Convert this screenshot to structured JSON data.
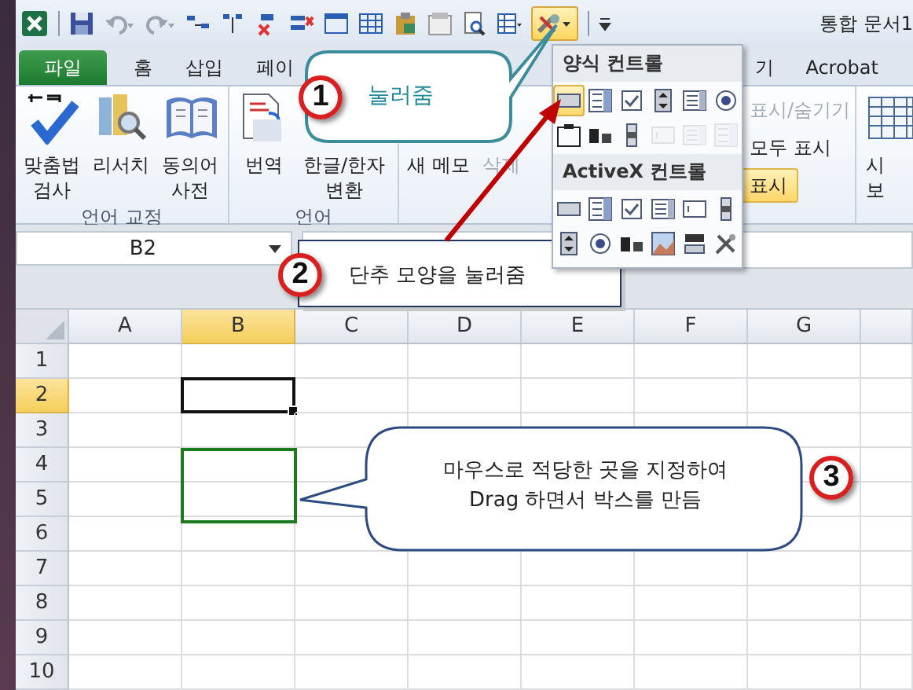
{
  "window": {
    "title": "통합 문서1"
  },
  "quick_access": {
    "controls_button": {
      "expanded": true
    }
  },
  "tabs": [
    {
      "label": "파일",
      "selected": true
    },
    {
      "label": "홈",
      "selected": false
    },
    {
      "label": "삽입",
      "selected": false
    },
    {
      "label": "페이",
      "selected": false
    },
    {
      "label": "기",
      "selected": false
    },
    {
      "label": "Acrobat",
      "selected": false
    }
  ],
  "ribbon": [
    {
      "kind": "large",
      "label": "언어 교정",
      "buttons": [
        {
          "label": "맞춤법\n검사"
        },
        {
          "label": "리서치"
        },
        {
          "label": "동의어\n사전"
        }
      ]
    },
    {
      "kind": "large",
      "label": "언어",
      "buttons": [
        {
          "label": "번역"
        },
        {
          "label": "한글/한자\n변환"
        }
      ]
    },
    {
      "kind": "text",
      "buttons": [
        {
          "label": "새 메모",
          "disabled": false
        },
        {
          "label": "삭제",
          "disabled": true
        }
      ]
    },
    {
      "kind": "small",
      "buttons": [
        {
          "label": "표시/숨기기",
          "disabled": true,
          "selected": false
        },
        {
          "label": "모두 표시",
          "disabled": false,
          "selected": false
        },
        {
          "label": "표시",
          "disabled": false,
          "selected": true
        }
      ]
    },
    {
      "kind": "large",
      "buttons": [
        {
          "label": "시\n보"
        }
      ]
    }
  ],
  "name_box": "B2",
  "columns": [
    {
      "label": "A",
      "selected": false
    },
    {
      "label": "B",
      "selected": true
    },
    {
      "label": "C",
      "selected": false
    },
    {
      "label": "D",
      "selected": false
    },
    {
      "label": "E",
      "selected": false
    },
    {
      "label": "F",
      "selected": false
    },
    {
      "label": "G",
      "selected": false
    }
  ],
  "rows": [
    {
      "label": "1",
      "selected": false
    },
    {
      "label": "2",
      "selected": true
    },
    {
      "label": "3",
      "selected": false
    },
    {
      "label": "4",
      "selected": false
    },
    {
      "label": "5",
      "selected": false
    },
    {
      "label": "6",
      "selected": false
    },
    {
      "label": "7",
      "selected": false
    },
    {
      "label": "8",
      "selected": false
    },
    {
      "label": "9",
      "selected": false
    },
    {
      "label": "10",
      "selected": false
    }
  ],
  "controls_menu": {
    "sections": [
      {
        "title": "양식 컨트롤",
        "items": [
          {
            "kind": "button",
            "selected": true,
            "disabled": false
          },
          {
            "kind": "combo",
            "selected": false,
            "disabled": false
          },
          {
            "kind": "checkbox",
            "selected": false,
            "disabled": false
          },
          {
            "kind": "spin",
            "selected": false,
            "disabled": false
          },
          {
            "kind": "list",
            "selected": false,
            "disabled": false
          },
          {
            "kind": "option",
            "selected": false,
            "disabled": false
          },
          {
            "kind": "groupbox",
            "selected": false,
            "disabled": false
          },
          {
            "kind": "label",
            "selected": false,
            "disabled": false
          },
          {
            "kind": "scrollbar",
            "selected": false,
            "disabled": false
          },
          {
            "kind": "textfield",
            "selected": false,
            "disabled": true
          },
          {
            "kind": "list",
            "selected": false,
            "disabled": true
          },
          {
            "kind": "combo",
            "selected": false,
            "disabled": true
          }
        ]
      },
      {
        "title": "ActiveX 컨트롤",
        "items": [
          {
            "kind": "button",
            "selected": false,
            "disabled": false
          },
          {
            "kind": "combo",
            "selected": false,
            "disabled": false
          },
          {
            "kind": "checkbox",
            "selected": false,
            "disabled": false
          },
          {
            "kind": "list",
            "selected": false,
            "disabled": false
          },
          {
            "kind": "textfield",
            "selected": false,
            "disabled": false
          },
          {
            "kind": "scrollbar",
            "selected": false,
            "disabled": false
          },
          {
            "kind": "spin",
            "selected": false,
            "disabled": false
          },
          {
            "kind": "option",
            "selected": false,
            "disabled": false
          },
          {
            "kind": "label",
            "selected": false,
            "disabled": false
          },
          {
            "kind": "image",
            "selected": false,
            "disabled": false
          },
          {
            "kind": "toggle",
            "selected": false,
            "disabled": false
          },
          {
            "kind": "tools",
            "selected": false,
            "disabled": false
          }
        ]
      }
    ]
  },
  "callouts": [
    {
      "kind": "rounded-teal",
      "badge": "1",
      "text": "눌러줌"
    },
    {
      "kind": "box",
      "badge": "2",
      "text": "단추 모양을 눌러줌"
    },
    {
      "kind": "rounded",
      "badge": "3",
      "text": "마우스로 적당한 곳을 지정하여\nDrag 하면서 박스를 만듬"
    }
  ]
}
